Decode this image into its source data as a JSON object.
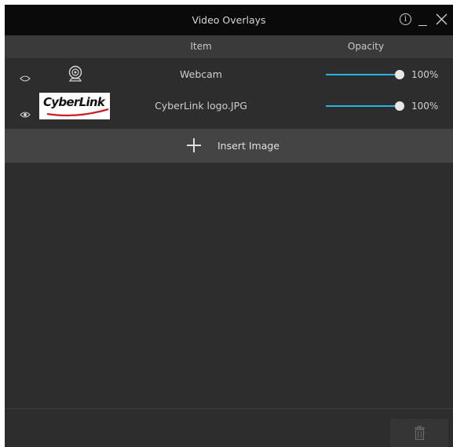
{
  "window": {
    "title": "Video Overlays",
    "controls": [
      "info-icon",
      "minimize-icon",
      "close-icon"
    ]
  },
  "table": {
    "headers": {
      "item": "Item",
      "opacity": "Opacity"
    },
    "rows": [
      {
        "visible": false,
        "thumbnail": "webcam-icon",
        "name": "Webcam",
        "opacity": "100%",
        "opacity_value": 1.0
      },
      {
        "visible": true,
        "thumbnail": "cyberlink-logo",
        "thumbnail_text": "CyberLink",
        "name": "CyberLink logo.JPG",
        "opacity": "100%",
        "opacity_value": 1.0
      }
    ]
  },
  "insert": {
    "label": "Insert Image",
    "icon": "plus-icon"
  },
  "footer": {
    "icon": "trash-icon"
  },
  "colors": {
    "accent": "#29b3e8",
    "background": "#2d2d2d",
    "titlebar": "#0a0a0a"
  }
}
